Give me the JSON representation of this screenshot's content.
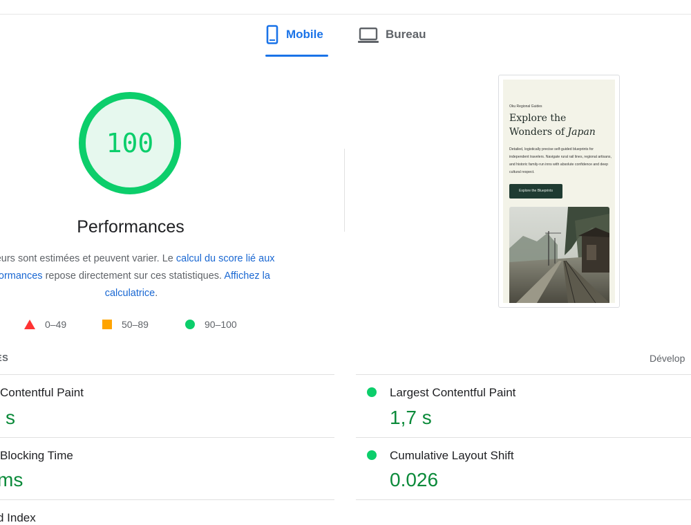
{
  "tabs": [
    {
      "label": "Mobile",
      "icon": "smartphone-icon",
      "active": true
    },
    {
      "label": "Bureau",
      "icon": "laptop-icon",
      "active": false
    }
  ],
  "score": {
    "value": "100",
    "category": "Performances",
    "fraction": 1.0,
    "color": "#0cce6b"
  },
  "description": {
    "prefix": "aleurs sont estimées et peuvent varier. Le ",
    "link1": "calcul du score lié aux",
    "link1b": "rformances",
    "middle": " repose directement sur ces statistiques. ",
    "link2": "Affichez la",
    "link3": "calculatrice",
    "suffix": "."
  },
  "legend": [
    {
      "shape": "triangle",
      "range": "0–49",
      "color": "#ff3333"
    },
    {
      "shape": "square",
      "range": "50–89",
      "color": "#ffa400"
    },
    {
      "shape": "circle",
      "range": "90–100",
      "color": "#0cce6b"
    }
  ],
  "preview": {
    "kicker": "Oku Regional Guides",
    "title_line1": "Explore the",
    "title_line2": "Wonders of ",
    "title_em": "Japan",
    "body": "Detailed, logistically precise self-guided blueprints for independent travelers. Navigate rural rail lines, regional artisans, and historic family-run inns with absolute confidence and deep cultural respect.",
    "button": "Explore the Blueprints"
  },
  "metrics": {
    "header_left": "ES",
    "header_right": "Dévelop",
    "items": [
      {
        "title": "Contentful Paint",
        "value": "s"
      },
      {
        "title": "Largest Contentful Paint",
        "value": "1,7 s"
      },
      {
        "title": "Blocking Time",
        "value": "ms"
      },
      {
        "title": "Cumulative Layout Shift",
        "value": "0.026"
      },
      {
        "title": "d Index",
        "value": ""
      }
    ]
  }
}
